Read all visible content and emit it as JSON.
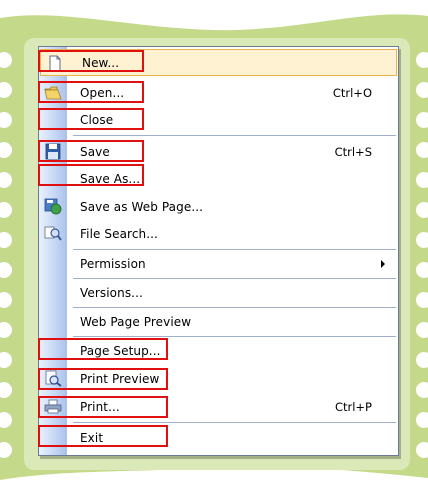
{
  "menu": {
    "items": [
      {
        "label": "New...",
        "shortcut": "",
        "icon": "new-document-icon"
      },
      {
        "label": "Open...",
        "shortcut": "Ctrl+O",
        "icon": "open-folder-icon"
      },
      {
        "label": "Close",
        "shortcut": "",
        "icon": ""
      },
      {
        "label": "Save",
        "shortcut": "Ctrl+S",
        "icon": "save-floppy-icon"
      },
      {
        "label": "Save As...",
        "shortcut": "",
        "icon": ""
      },
      {
        "label": "Save as Web Page...",
        "shortcut": "",
        "icon": "save-web-page-icon"
      },
      {
        "label": "File Search...",
        "shortcut": "",
        "icon": "file-search-icon"
      },
      {
        "label": "Permission",
        "shortcut": "",
        "icon": "",
        "submenu": true
      },
      {
        "label": "Versions...",
        "shortcut": "",
        "icon": ""
      },
      {
        "label": "Web Page Preview",
        "shortcut": "",
        "icon": ""
      },
      {
        "label": "Page Setup...",
        "shortcut": "",
        "icon": ""
      },
      {
        "label": "Print Preview",
        "shortcut": "",
        "icon": "print-preview-icon"
      },
      {
        "label": "Print...",
        "shortcut": "Ctrl+P",
        "icon": "printer-icon"
      },
      {
        "label": "Exit",
        "shortcut": "",
        "icon": ""
      }
    ]
  },
  "colors": {
    "background": "#c4d98a",
    "highlight": "#fff2d2",
    "annotation_box": "#e01010",
    "gutter": "#c7d8f5"
  }
}
